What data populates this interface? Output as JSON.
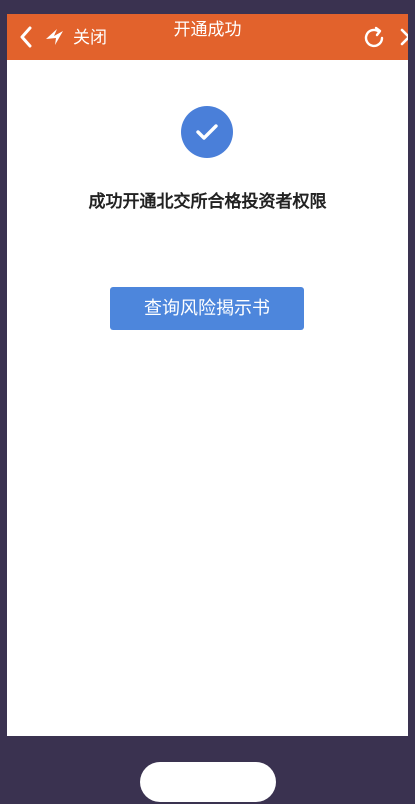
{
  "header": {
    "close_label": "关闭",
    "title": "开通成功",
    "accent_color": "#e2622c"
  },
  "icons": {
    "back": "chevron-left-icon",
    "logo": "brand-logo-icon",
    "refresh": "refresh-icon",
    "more": "chevron-right-icon",
    "success": "check-icon"
  },
  "main": {
    "success_message": "成功开通北交所合格投资者权限",
    "risk_button_label": "查询风险揭示书",
    "primary_color": "#4d86dc"
  }
}
